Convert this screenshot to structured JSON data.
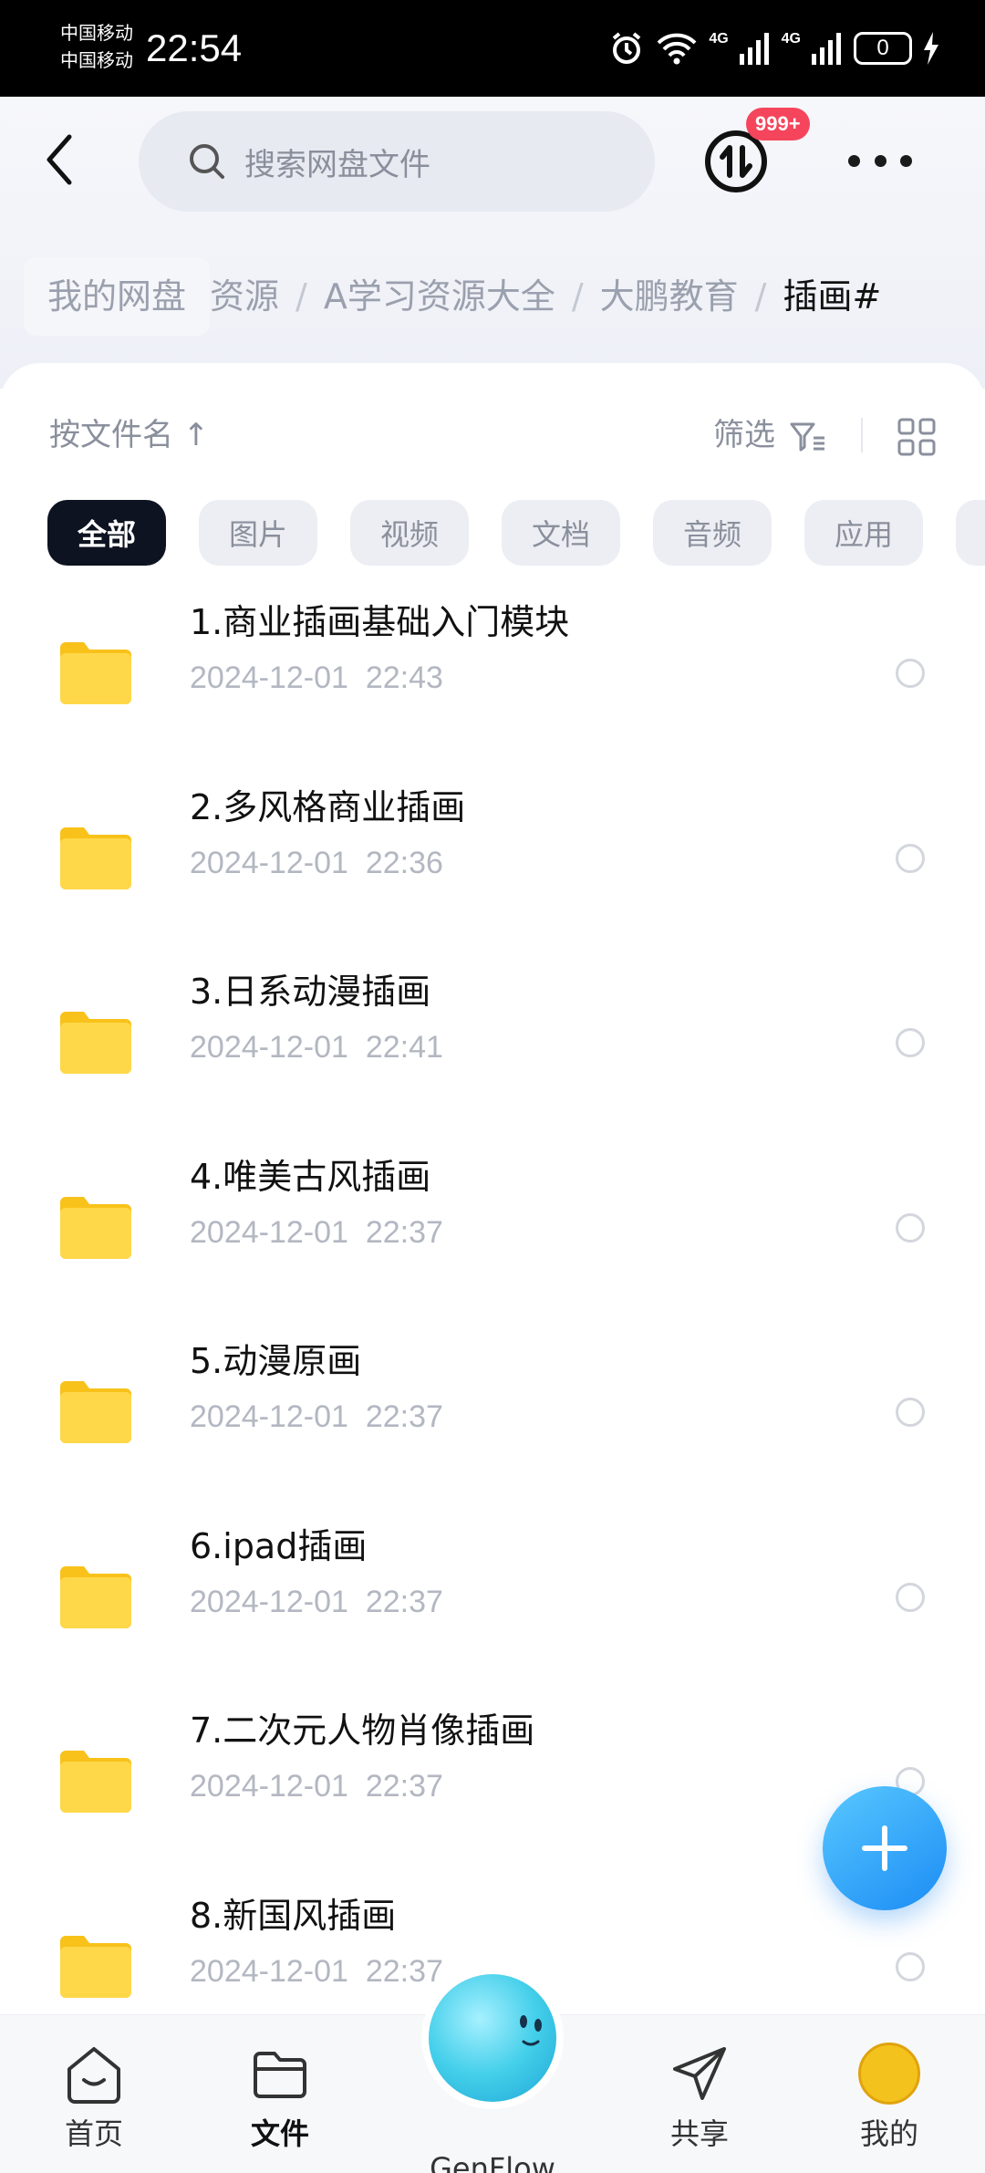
{
  "status": {
    "carrier1": "中国移动",
    "carrier2": "中国移动",
    "time": "22:54",
    "network1": "4G",
    "network2": "4G",
    "battery": "0"
  },
  "header": {
    "search_placeholder": "搜索网盘文件",
    "badge": "999+"
  },
  "breadcrumb": {
    "root": "我的网盘",
    "items": [
      "资源",
      "A学习资源大全",
      "大鹏教育",
      "插画#"
    ]
  },
  "toolbar": {
    "sort_label": "按文件名 ↑",
    "filter_label": "筛选"
  },
  "filters": [
    "全部",
    "图片",
    "视频",
    "文档",
    "音频",
    "应用"
  ],
  "files": [
    {
      "name": "1.商业插画基础入门模块",
      "date": "2024-12-01",
      "time": "22:43"
    },
    {
      "name": "2.多风格商业插画",
      "date": "2024-12-01",
      "time": "22:36"
    },
    {
      "name": "3.日系动漫插画",
      "date": "2024-12-01",
      "time": "22:41"
    },
    {
      "name": "4.唯美古风插画",
      "date": "2024-12-01",
      "time": "22:37"
    },
    {
      "name": "5.动漫原画",
      "date": "2024-12-01",
      "time": "22:37"
    },
    {
      "name": "6.ipad插画",
      "date": "2024-12-01",
      "time": "22:37"
    },
    {
      "name": "7.二次元人物肖像插画",
      "date": "2024-12-01",
      "time": "22:37"
    },
    {
      "name": "8.新国风插画",
      "date": "2024-12-01",
      "time": "22:37"
    }
  ],
  "tabs": {
    "home": "首页",
    "files": "文件",
    "genflow": "GenFlow",
    "share": "共享",
    "mine": "我的"
  },
  "colors": {
    "accent": "#1c8cf5",
    "folder": "#ffd23f",
    "badge": "#f5455c"
  }
}
